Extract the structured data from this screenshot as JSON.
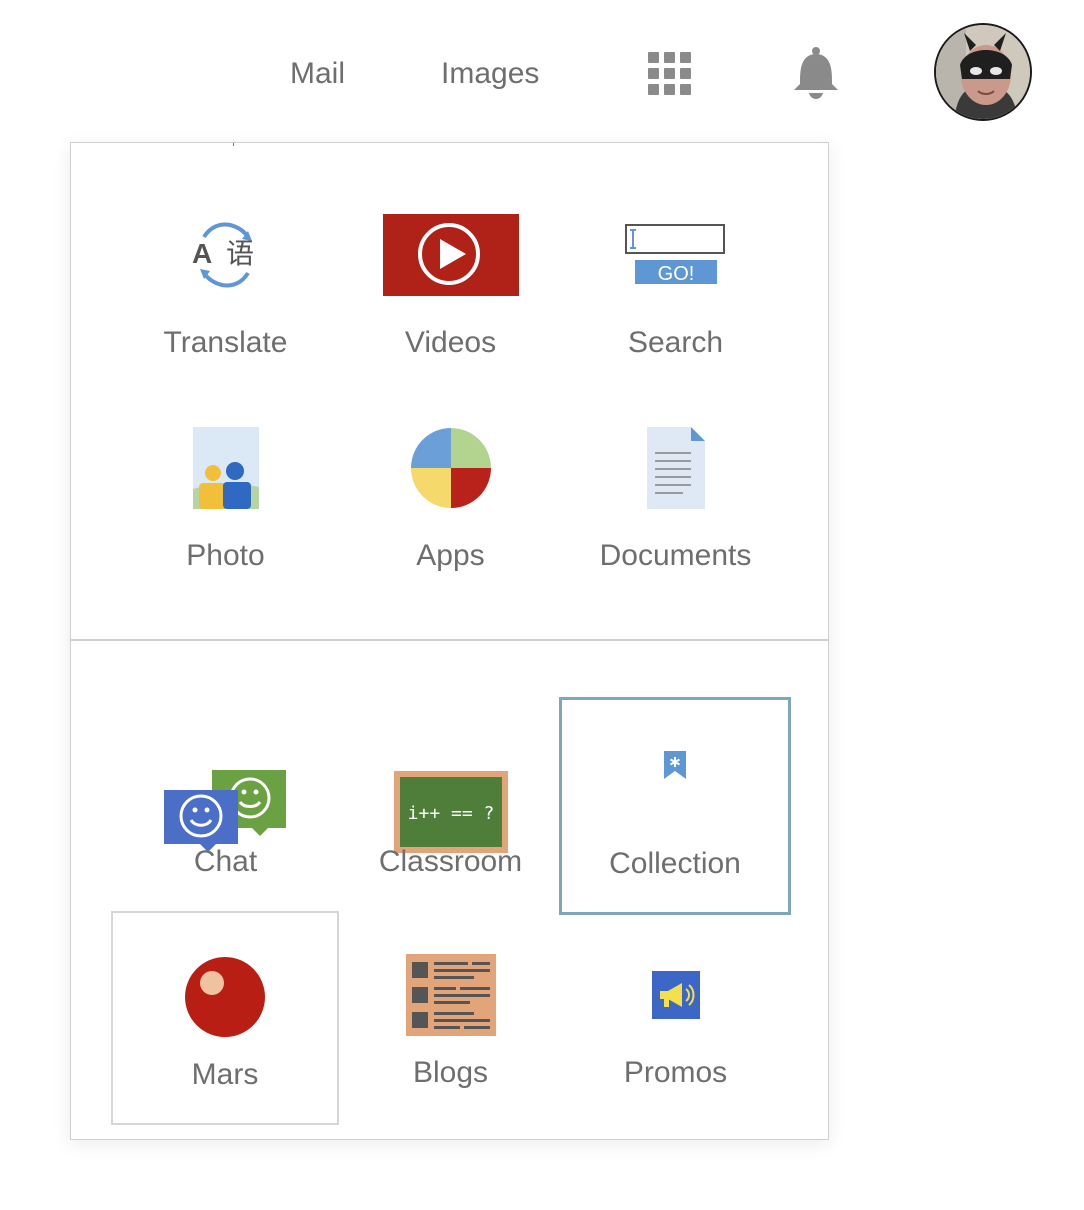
{
  "header": {
    "links": [
      "Mail",
      "Images"
    ],
    "icons": [
      "apps-grid-icon",
      "notifications-bell-icon"
    ],
    "avatar": "user-avatar"
  },
  "launcher": {
    "primary": [
      {
        "label": "Translate",
        "icon": "translate-icon"
      },
      {
        "label": "Videos",
        "icon": "video-play-icon"
      },
      {
        "label": "Search",
        "icon": "search-go-icon"
      },
      {
        "label": "Photo",
        "icon": "photo-people-icon"
      },
      {
        "label": "Apps",
        "icon": "apps-pie-icon"
      },
      {
        "label": "Documents",
        "icon": "document-icon"
      }
    ],
    "secondary": [
      {
        "label": "Chat",
        "icon": "chat-bubbles-icon"
      },
      {
        "label": "Classroom",
        "icon": "chalkboard-icon",
        "board_text": "i++ == ?"
      },
      {
        "label": "Collection",
        "icon": "bookmark-icon"
      },
      {
        "label": "Mars",
        "icon": "mars-planet-icon"
      },
      {
        "label": "Blogs",
        "icon": "blog-icon"
      },
      {
        "label": "Promos",
        "icon": "megaphone-icon"
      }
    ],
    "search_icon_text": "GO!",
    "translate_glyphs": [
      "A",
      "语"
    ]
  },
  "colors": {
    "text_gray": "#6e6e6e",
    "video_red": "#b02117",
    "search_blue": "#5f97d4",
    "selected_border": "#7ea7b8",
    "mars_red": "#b81e14",
    "chat_blue": "#4b6fc6",
    "chat_green": "#6aa142",
    "board_green": "#4f7e3a",
    "board_frame": "#e2a57a",
    "promo_blue": "#3c67c7"
  }
}
